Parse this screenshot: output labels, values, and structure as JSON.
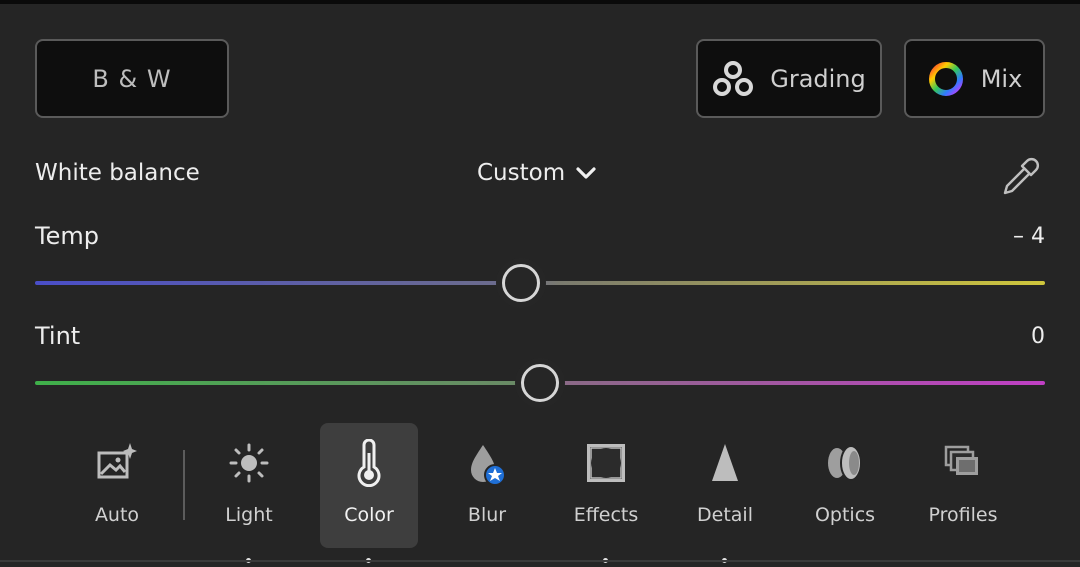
{
  "top_buttons": {
    "bw_label": "B & W",
    "grading_label": "Grading",
    "mix_label": "Mix"
  },
  "white_balance": {
    "label": "White balance",
    "selected": "Custom"
  },
  "sliders": {
    "temp": {
      "label": "Temp",
      "value": "– 4"
    },
    "tint": {
      "label": "Tint",
      "value": "0"
    }
  },
  "toolbar": {
    "items": [
      {
        "label": "Auto",
        "icon": "auto-icon"
      },
      {
        "label": "Light",
        "icon": "sun-icon"
      },
      {
        "label": "Color",
        "icon": "thermometer-icon",
        "active": true
      },
      {
        "label": "Blur",
        "icon": "blur-drop-icon"
      },
      {
        "label": "Effects",
        "icon": "effects-icon"
      },
      {
        "label": "Detail",
        "icon": "detail-triangle-icon"
      },
      {
        "label": "Optics",
        "icon": "optics-lens-icon"
      },
      {
        "label": "Profiles",
        "icon": "profiles-icon"
      }
    ]
  },
  "colors": {
    "accent_blue": "#1f6fd6",
    "background": "#252525",
    "active_tool_bg": "#3e3e3e"
  }
}
